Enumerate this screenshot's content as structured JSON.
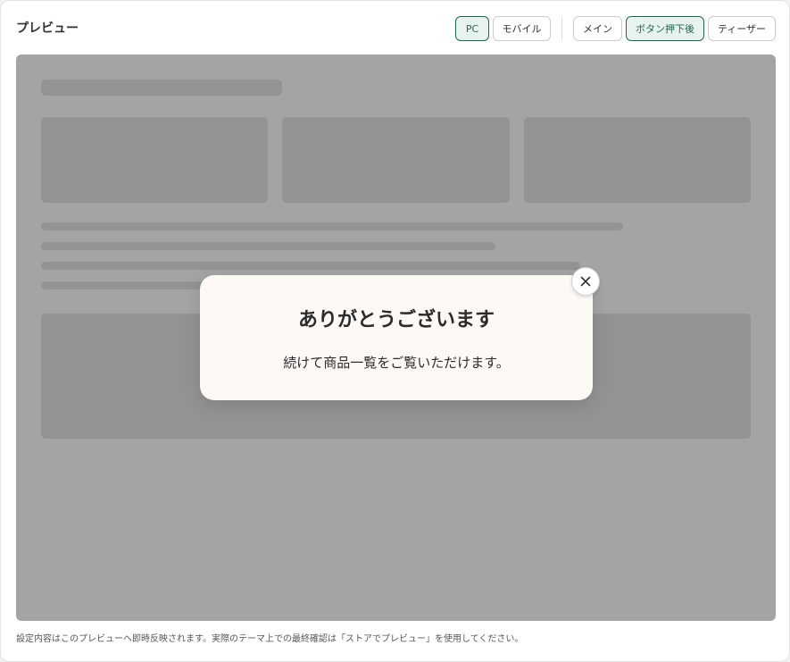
{
  "header": {
    "title": "プレビュー",
    "device_toggle": [
      {
        "label": "PC",
        "active": true
      },
      {
        "label": "モバイル",
        "active": false
      }
    ],
    "view_toggle": [
      {
        "label": "メイン",
        "active": false
      },
      {
        "label": "ボタン押下後",
        "active": true
      },
      {
        "label": "ティーザー",
        "active": false
      }
    ]
  },
  "modal": {
    "title": "ありがとうございます",
    "body": "続けて商品一覧をご覧いただけます。",
    "close_icon": "close-icon"
  },
  "footer": {
    "note": "設定内容はこのプレビューへ即時反映されます。実際のテーマ上での最終確認は「ストアでプレビュー」を使用してください。"
  },
  "colors": {
    "accent": "#1f6a49",
    "accent_bg": "#e9f3ee",
    "overlay": "#a4a4a4",
    "placeholder": "#939393",
    "modal_bg": "#fdf9f4"
  }
}
